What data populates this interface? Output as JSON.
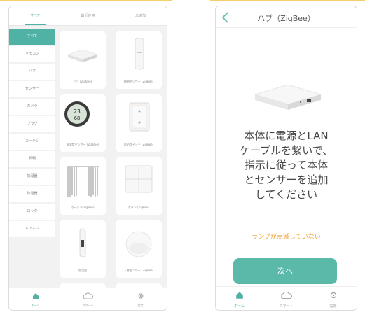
{
  "left_phone": {
    "tabs": [
      {
        "label": "すべて",
        "active": true
      },
      {
        "label": "最近使用",
        "active": false
      },
      {
        "label": "未追加",
        "active": false
      }
    ],
    "categories": [
      {
        "label": "すべて",
        "active": true
      },
      {
        "label": "リモコン"
      },
      {
        "label": "ハブ"
      },
      {
        "label": "センサー"
      },
      {
        "label": "カメラ"
      },
      {
        "label": "プラグ"
      },
      {
        "label": "カーテン"
      },
      {
        "label": "照明"
      },
      {
        "label": "加湿器"
      },
      {
        "label": "除湿器"
      },
      {
        "label": "ロック"
      },
      {
        "label": "ドアホン"
      }
    ],
    "devices": [
      {
        "label": "ハブ (ZigBee)",
        "icon": "hub-device-icon"
      },
      {
        "label": "開閉センサー (ZigBee)",
        "icon": "door-sensor-icon"
      },
      {
        "label": "温湿度センサー (ZigBee)",
        "icon": "thermometer-icon"
      },
      {
        "label": "照明スイッチ (ZigBee)",
        "icon": "wall-switch-icon"
      },
      {
        "label": "カーテン(ZigBee)",
        "icon": "curtain-icon"
      },
      {
        "label": "ボタン (ZigBee)",
        "icon": "button-panel-icon"
      },
      {
        "label": "加湿器",
        "icon": "humidifier-icon"
      },
      {
        "label": "人感センサー (ZigBee)",
        "icon": "motion-sensor-icon"
      }
    ],
    "bottom_nav": [
      {
        "label": "ホーム",
        "icon": "home-icon",
        "active": true
      },
      {
        "label": "スマート",
        "icon": "cloud-icon",
        "active": false
      },
      {
        "label": "設定",
        "icon": "gear-icon",
        "active": false
      }
    ]
  },
  "right_phone": {
    "title": "ハブ（ZigBee）",
    "instruction": "本体に電源とLAN\nケーブルを繋いで、\n指示に従って本体\nとセンサーを追加\nしてください",
    "blink_link": "ランプが点滅していない",
    "next_button": "次へ",
    "bottom_nav": [
      {
        "label": "ホーム",
        "icon": "home-icon",
        "active": true
      },
      {
        "label": "スマート",
        "icon": "cloud-icon",
        "active": false
      },
      {
        "label": "設定",
        "icon": "gear-icon",
        "active": false
      }
    ]
  },
  "colors": {
    "accent": "#4fb2a4",
    "button": "#5ab9a9",
    "link": "#f0a640",
    "highlight_bar": "#f4cf6a"
  }
}
